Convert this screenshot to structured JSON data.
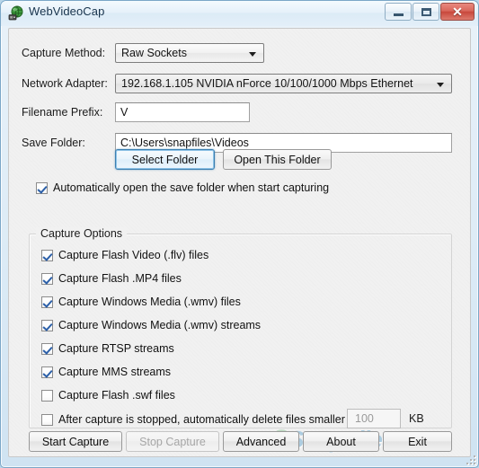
{
  "window": {
    "title": "WebVideoCap",
    "icon": "globe-camera-icon",
    "controls": {
      "minimize": "minimize-button",
      "maximize": "maximize-button",
      "close_glyph": "✕"
    }
  },
  "form": {
    "capture_method": {
      "label": "Capture Method:",
      "value": "Raw Sockets"
    },
    "network_adapter": {
      "label": "Network Adapter:",
      "value": "192.168.1.105   NVIDIA nForce 10/100/1000 Mbps Ethernet"
    },
    "filename_prefix": {
      "label": "Filename Prefix:",
      "value": "V",
      "placeholder": ""
    },
    "save_folder": {
      "label": "Save Folder:",
      "value": "C:\\Users\\snapfiles\\Videos",
      "placeholder": ""
    }
  },
  "folder_buttons": {
    "select_folder": "Select Folder",
    "open_this_folder": "Open This Folder"
  },
  "auto_open": {
    "label": "Automatically open the save folder when start capturing",
    "checked": true
  },
  "capture_options": {
    "group_label": "Capture Options",
    "items": [
      {
        "label": "Capture Flash Video (.flv) files",
        "checked": true
      },
      {
        "label": "Capture Flash .MP4 files",
        "checked": true
      },
      {
        "label": "Capture Windows Media (.wmv) files",
        "checked": true
      },
      {
        "label": "Capture Windows Media (.wmv) streams",
        "checked": true
      },
      {
        "label": "Capture RTSP streams",
        "checked": true
      },
      {
        "label": "Capture MMS streams",
        "checked": true
      },
      {
        "label": "Capture Flash .swf files",
        "checked": false
      }
    ],
    "delete_small": {
      "label": "After capture is stopped, automatically delete files smaller than:",
      "checked": false,
      "value": "100",
      "unit": "KB",
      "enabled": false
    }
  },
  "action_buttons": [
    {
      "label": "Start Capture",
      "enabled": true
    },
    {
      "label": "Stop Capture",
      "enabled": false
    },
    {
      "label": "Advanced",
      "enabled": true
    },
    {
      "label": "About",
      "enabled": true
    },
    {
      "label": "Exit",
      "enabled": true
    }
  ],
  "watermark": {
    "logo": "S",
    "text": "SnapFiles"
  },
  "colors": {
    "accent_focus": "#3c7fb1",
    "close_button": "#c8483c",
    "checkmark": "#2b5fa8",
    "dialog_bg": "#f1f1f1",
    "watermark_text": "#a9cbe0"
  }
}
